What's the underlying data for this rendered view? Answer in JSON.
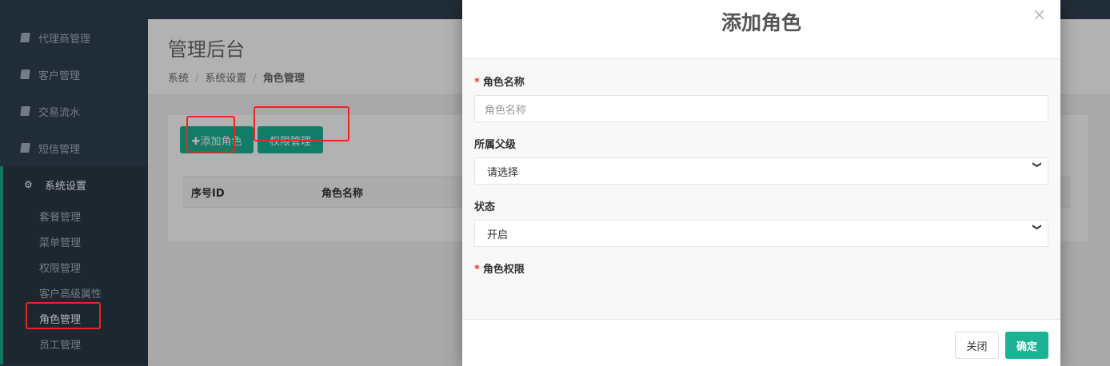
{
  "sidebar": {
    "items": [
      {
        "label": "代理商管理",
        "icon": "book-icon"
      },
      {
        "label": "客户管理",
        "icon": "book-icon"
      },
      {
        "label": "交易流水",
        "icon": "book-icon"
      },
      {
        "label": "短信管理",
        "icon": "book-icon"
      }
    ],
    "group": {
      "label": "系统设置",
      "icon": "gear-icon",
      "items": [
        {
          "label": "套餐管理"
        },
        {
          "label": "菜单管理"
        },
        {
          "label": "权限管理"
        },
        {
          "label": "客户高级属性"
        },
        {
          "label": "角色管理"
        },
        {
          "label": "员工管理"
        }
      ]
    }
  },
  "main": {
    "title": "管理后台",
    "breadcrumb": [
      "系统",
      "系统设置",
      "角色管理"
    ],
    "buttons": {
      "add": "✚添加角色",
      "perm": "权限管理"
    },
    "table_headers": [
      "序号ID",
      "角色名称"
    ]
  },
  "modal": {
    "title": "添加角色",
    "close_icon": "×",
    "fields": {
      "role_name_label": "角色名称",
      "role_name_placeholder": "角色名称",
      "parent_label": "所属父级",
      "parent_value": "请选择",
      "status_label": "状态",
      "status_value": "开启",
      "permission_label": "角色权限"
    },
    "required_mark": "*",
    "footer": {
      "close": "关闭",
      "confirm": "确定"
    }
  },
  "colors": {
    "sidebar": "#2f4050",
    "accent": "#1ab394",
    "annotation": "#e8281f"
  }
}
